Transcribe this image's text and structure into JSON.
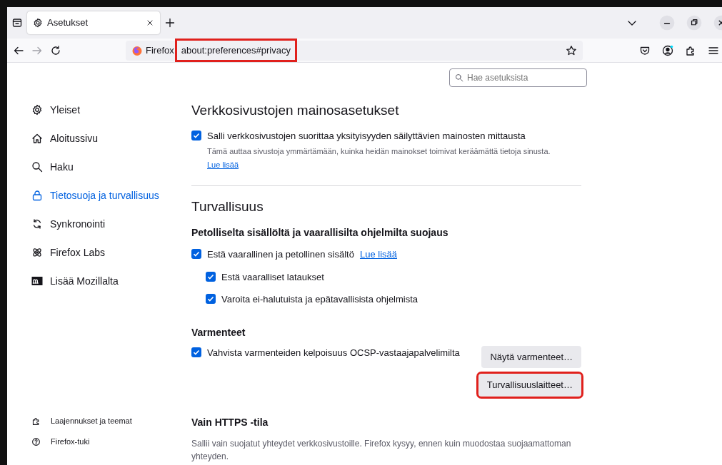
{
  "tabs": [
    {
      "label": "Asetukset",
      "selected": true
    }
  ],
  "toolbar": {
    "identity_label": "Firefox",
    "url": "about:preferences#privacy",
    "url_highlighted": true
  },
  "search": {
    "placeholder": "Hae asetuksista"
  },
  "sidebar": {
    "items": [
      {
        "label": "Yleiset",
        "selected": false
      },
      {
        "label": "Aloitussivu",
        "selected": false
      },
      {
        "label": "Haku",
        "selected": false
      },
      {
        "label": "Tietosuoja ja turvallisuus",
        "selected": true
      },
      {
        "label": "Synkronointi",
        "selected": false
      },
      {
        "label": "Firefox Labs",
        "selected": false
      },
      {
        "label": "Lisää Mozillalta",
        "selected": false
      }
    ],
    "footer": [
      {
        "label": "Laajennukset ja teemat"
      },
      {
        "label": "Firefox-tuki"
      }
    ]
  },
  "sections": [
    {
      "title": "Verkkosivustojen mainosasetukset",
      "blocks": [
        {
          "kind": "checkbox",
          "label": "Salli verkkosivustojen suorittaa yksityisyyden säilyttävien mainosten mittausta",
          "checked": true,
          "description": "Tämä auttaa sivustoja ymmärtämään, kuinka heidän mainokset toimivat keräämättä tietoja sinusta.",
          "link": "Lue lisää"
        }
      ]
    },
    {
      "title": "Turvallisuus",
      "blocks": [
        {
          "kind": "subheading",
          "label": "Petolliselta sisällöltä ja vaarallisilta ohjelmilta suojaus"
        },
        {
          "kind": "checkbox",
          "label": "Estä vaarallinen ja petollinen sisältö",
          "checked": true,
          "inline_link": "Lue lisää"
        },
        {
          "kind": "subcheckbox",
          "label": "Estä vaaralliset lataukset",
          "checked": true
        },
        {
          "kind": "subcheckbox",
          "label": "Varoita ei-halutuista ja epätavallisista ohjelmista",
          "checked": true
        },
        {
          "kind": "subheading",
          "label": "Varmenteet"
        },
        {
          "kind": "checkbox",
          "label": "Vahvista varmenteiden kelpoisuus OCSP-vastaajapalvelimilta",
          "checked": true,
          "buttons": [
            {
              "label": "Näytä varmenteet…",
              "highlighted": false
            },
            {
              "label": "Turvallisuuslaitteet…",
              "highlighted": true
            }
          ]
        },
        {
          "kind": "subheading",
          "label": "Vain HTTPS -tila"
        },
        {
          "kind": "text",
          "label": "Sallii vain suojatut yhteydet verkkosivustoille. Firefox kysyy, ennen kuin muodostaa suojaamattoman yhteyden."
        }
      ]
    }
  ]
}
